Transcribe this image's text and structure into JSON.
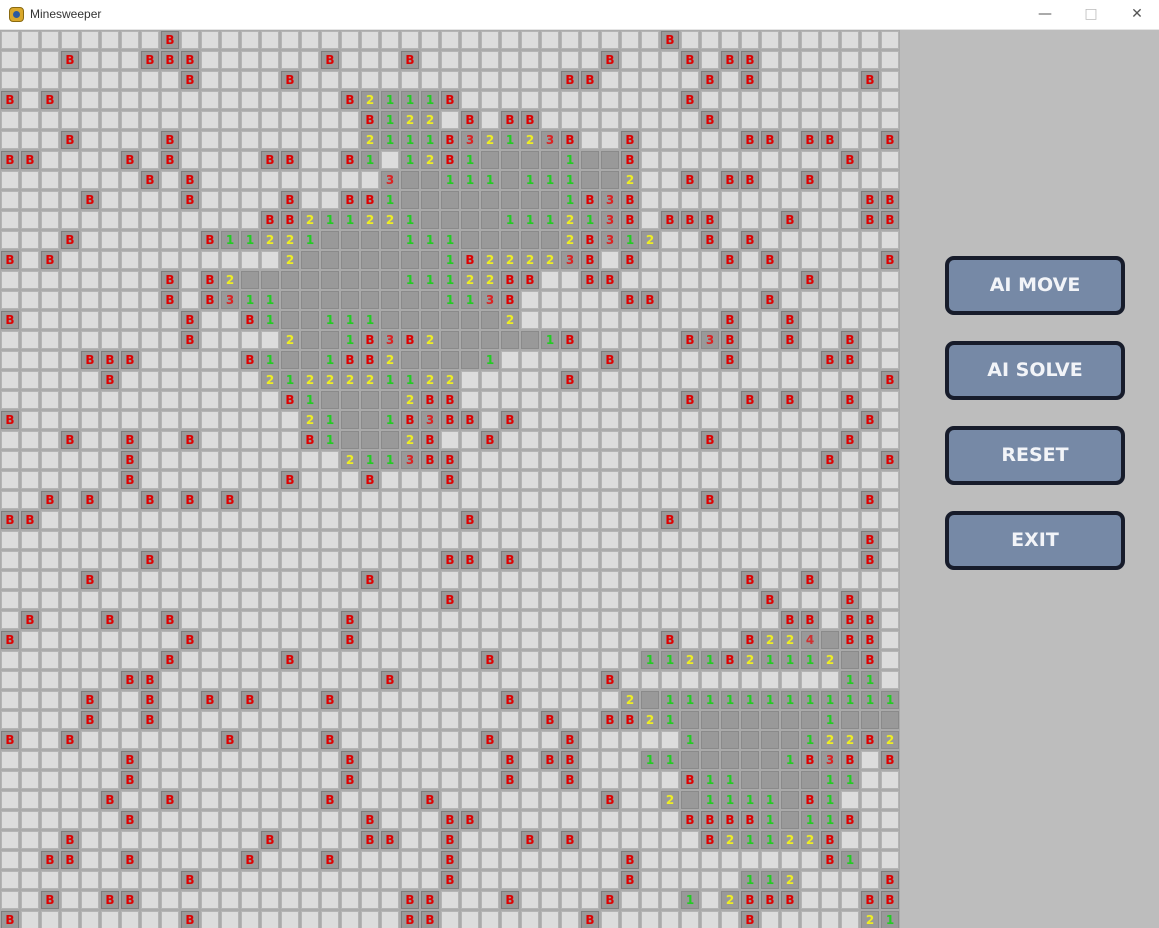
{
  "window": {
    "title": "Minesweeper",
    "icon": "pygame-snake-icon",
    "controls": {
      "minimize": "—",
      "maximize": "□",
      "close": "✕"
    }
  },
  "colors": {
    "bomb_text": "#e00000",
    "n1": "#22cc22",
    "n2": "#eeee22",
    "n3": "#dd2222",
    "n4": "#d03030",
    "button_bg": "#7689a6",
    "button_border": "#171c2b"
  },
  "controls": {
    "ai_move": "AI MOVE",
    "ai_solve": "AI SOLVE",
    "reset": "RESET",
    "exit": "EXIT"
  },
  "board": {
    "cols": 45,
    "rows": 45,
    "legend": "'.' hidden cell, 'B' flagged bomb, '0' revealed empty, '1'-'4' revealed number",
    "grid": [
      "........B........................B...........",
      "...B...BBB......B...B.........B...B.BB.......",
      ".........B....B.............BB.....B.B.....B.",
      "B.B..............B2111B...........B..........",
      "..................B122.B.BB........B.........",
      "...B....B.........2111B32123B..B.....BB.BB..B",
      "BB....B.B....BB..B1.12B10000100B..........B..",
      ".......B.B.........3001110111002..B.BB..B....",
      "....B....B....B..BB1000000001B3B...........BB",
      ".............BB2112210000111213B.BBB...B...BB",
      "...B......B112210000111000002B312..B.B.......",
      "B.B...........200000001B22223B.B....B.B.....B",
      "........B.B20000000011122BB..BB.........B....",
      "........B.B31100000000113B.....BB.....B......",
      "B........B..B1001110000002..........B..B.....",
      ".........B....2001B3B2000001B.....B3B..B..B..B..",
      "....BBB.....B1001BB200001.....B.....B....BB..B.",
      ".....B.......2122221122.....B...............B.",
      "..............B100002BB...........B..B.B..B..B",
      "B..............21001B3BB.B.................B...",
      "...B..B..B.....B10002B..B..........B......B...",
      "......B..........2113BB..................B..B",
      "......B.......B...B...B.......................",
      "..B.B..B.B.B.......................B.......B.",
      "BB.....................B.........B...........",
      "...........................................B.",
      ".......B..............BB.B.................B..",
      "....B.............B..................B..B....",
      "......................B...............B...B..",
      ".B...B..B........B.....................BB.BB.",
      "B........B.......B...............B...B2240BB.",
      "........B.....B.........B.......1121B211120B.B",
      "......BB...........B..........B...........11",
      "....B..B..B.B...B........B.....201111111111111",
      "....B..B...................B..BB2100000001000",
      "B..B.......B....B.......B...B.....100000122B21111",
      "......B..........B.......B.BB...11000001B3B.B1",
      "......B..........B.......B..B.....B11000011..2110",
      ".....B..B.......B....B........B..2011110B1.....",
      "......B...........B...BB..........BBBB1011B....1..",
      "...B.........B....BB..B...B.B......B21122B.....11",
      "..BB..B.....B...B.....B........B.........B1......",
      ".........B............B........B.....112....B.310",
      "..B..BB.............BB...B....B...1.2BBB...BB10.",
      "B........B..........BB.......B.......B.....21"
    ]
  }
}
